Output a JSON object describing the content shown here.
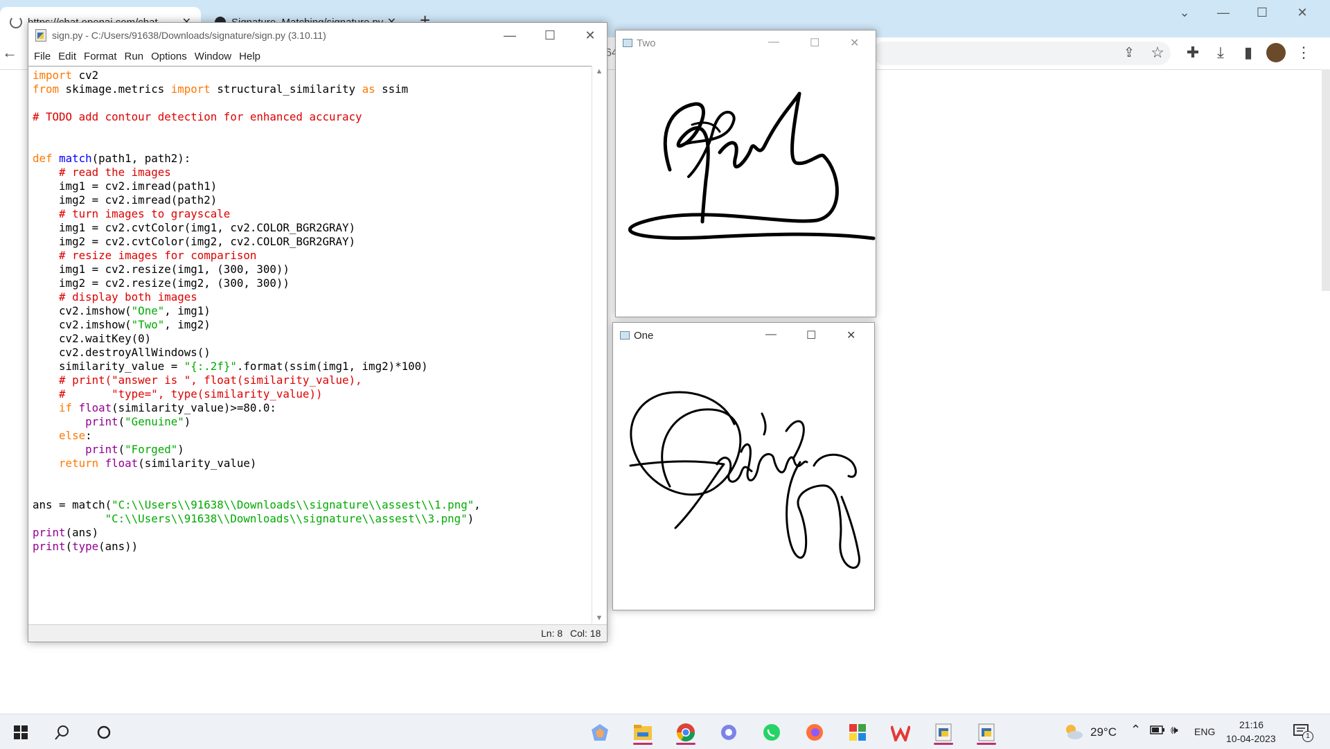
{
  "browser": {
    "tabs": [
      {
        "label": "https://chat.openai.com/chat",
        "active": true
      },
      {
        "label": "Signature_Matching/signature.py",
        "active": false
      }
    ],
    "new_tab": "+",
    "address_fragment": "64",
    "icons": [
      "back-arrow-icon",
      "share-icon",
      "star-icon",
      "extensions-icon",
      "download-icon",
      "sidepanel-icon",
      "avatar",
      "kebab-menu-icon"
    ]
  },
  "idle": {
    "title": "sign.py - C:/Users/91638/Downloads/signature/sign.py (3.10.11)",
    "menu": [
      "File",
      "Edit",
      "Format",
      "Run",
      "Options",
      "Window",
      "Help"
    ],
    "status": {
      "line": "Ln: 8",
      "col": "Col: 18"
    },
    "code": [
      [
        {
          "t": "import",
          "c": "kw"
        },
        {
          "t": " cv2"
        }
      ],
      [
        {
          "t": "from",
          "c": "kw"
        },
        {
          "t": " skimage.metrics "
        },
        {
          "t": "import",
          "c": "kw"
        },
        {
          "t": " structural_similarity "
        },
        {
          "t": "as",
          "c": "kw"
        },
        {
          "t": " ssim"
        }
      ],
      [],
      [
        {
          "t": "# TODO add contour detection for enhanced accuracy",
          "c": "cm"
        }
      ],
      [],
      [],
      [
        {
          "t": "def",
          "c": "kw"
        },
        {
          "t": " "
        },
        {
          "t": "match",
          "c": "df"
        },
        {
          "t": "(path1, path2):"
        }
      ],
      [
        {
          "t": "    "
        },
        {
          "t": "# read the images",
          "c": "cm"
        }
      ],
      [
        {
          "t": "    img1 = cv2.imread(path1)"
        }
      ],
      [
        {
          "t": "    img2 = cv2.imread(path2)"
        }
      ],
      [
        {
          "t": "    "
        },
        {
          "t": "# turn images to grayscale",
          "c": "cm"
        }
      ],
      [
        {
          "t": "    img1 = cv2.cvtColor(img1, cv2.COLOR_BGR2GRAY)"
        }
      ],
      [
        {
          "t": "    img2 = cv2.cvtColor(img2, cv2.COLOR_BGR2GRAY)"
        }
      ],
      [
        {
          "t": "    "
        },
        {
          "t": "# resize images for comparison",
          "c": "cm"
        }
      ],
      [
        {
          "t": "    img1 = cv2.resize(img1, (300, 300))"
        }
      ],
      [
        {
          "t": "    img2 = cv2.resize(img2, (300, 300))"
        }
      ],
      [
        {
          "t": "    "
        },
        {
          "t": "# display both images",
          "c": "cm"
        }
      ],
      [
        {
          "t": "    cv2.imshow("
        },
        {
          "t": "\"One\"",
          "c": "st"
        },
        {
          "t": ", img1)"
        }
      ],
      [
        {
          "t": "    cv2.imshow("
        },
        {
          "t": "\"Two\"",
          "c": "st"
        },
        {
          "t": ", img2)"
        }
      ],
      [
        {
          "t": "    cv2.waitKey(0)"
        }
      ],
      [
        {
          "t": "    cv2.destroyAllWindows()"
        }
      ],
      [
        {
          "t": "    similarity_value = "
        },
        {
          "t": "\"{:.2f}\"",
          "c": "st"
        },
        {
          "t": ".format(ssim(img1, img2)*100)"
        }
      ],
      [
        {
          "t": "    "
        },
        {
          "t": "# print(\"answer is \", float(similarity_value),",
          "c": "cm"
        }
      ],
      [
        {
          "t": "    "
        },
        {
          "t": "#       \"type=\", type(similarity_value))",
          "c": "cm"
        }
      ],
      [
        {
          "t": "    "
        },
        {
          "t": "if",
          "c": "kw"
        },
        {
          "t": " "
        },
        {
          "t": "float",
          "c": "bi"
        },
        {
          "t": "(similarity_value)>=80.0:"
        }
      ],
      [
        {
          "t": "        "
        },
        {
          "t": "print",
          "c": "bi"
        },
        {
          "t": "("
        },
        {
          "t": "\"Genuine\"",
          "c": "st"
        },
        {
          "t": ")"
        }
      ],
      [
        {
          "t": "    "
        },
        {
          "t": "else",
          "c": "kw"
        },
        {
          "t": ":"
        }
      ],
      [
        {
          "t": "        "
        },
        {
          "t": "print",
          "c": "bi"
        },
        {
          "t": "("
        },
        {
          "t": "\"Forged\"",
          "c": "st"
        },
        {
          "t": ")"
        }
      ],
      [
        {
          "t": "    "
        },
        {
          "t": "return",
          "c": "kw"
        },
        {
          "t": " "
        },
        {
          "t": "float",
          "c": "bi"
        },
        {
          "t": "(similarity_value)"
        }
      ],
      [],
      [],
      [
        {
          "t": "ans = match("
        },
        {
          "t": "\"C:\\\\Users\\\\91638\\\\Downloads\\\\signature\\\\assest\\\\1.png\"",
          "c": "st"
        },
        {
          "t": ","
        }
      ],
      [
        {
          "t": "           "
        },
        {
          "t": "\"C:\\\\Users\\\\91638\\\\Downloads\\\\signature\\\\assest\\\\3.png\"",
          "c": "st"
        },
        {
          "t": ")"
        }
      ],
      [
        {
          "t": "print",
          "c": "bi"
        },
        {
          "t": "(ans)"
        }
      ],
      [
        {
          "t": "print",
          "c": "bi"
        },
        {
          "t": "("
        },
        {
          "t": "type",
          "c": "bi"
        },
        {
          "t": "(ans))"
        }
      ]
    ]
  },
  "windows": {
    "two": {
      "title": "Two"
    },
    "one": {
      "title": "One"
    }
  },
  "taskbar": {
    "apps": [
      "windows-start-icon",
      "search-icon",
      "cortana-icon",
      "copilot-icon",
      "file-explorer-icon",
      "chrome-icon",
      "teams-icon",
      "whatsapp-icon",
      "firefox-icon",
      "app-grid-icon",
      "wps-icon",
      "idle-icon",
      "idle-icon-2"
    ],
    "weather": "29°C",
    "language": "ENG",
    "time": "21:16",
    "date": "10-04-2023",
    "notifications": "1"
  },
  "colors": {
    "keyword": "#ff7700",
    "builtin": "#900090",
    "defname": "#0000ff",
    "comment": "#dd0000",
    "string": "#00aa00",
    "chrome_tabbar": "#cfe6f6",
    "taskbar": "#eef2f7"
  }
}
